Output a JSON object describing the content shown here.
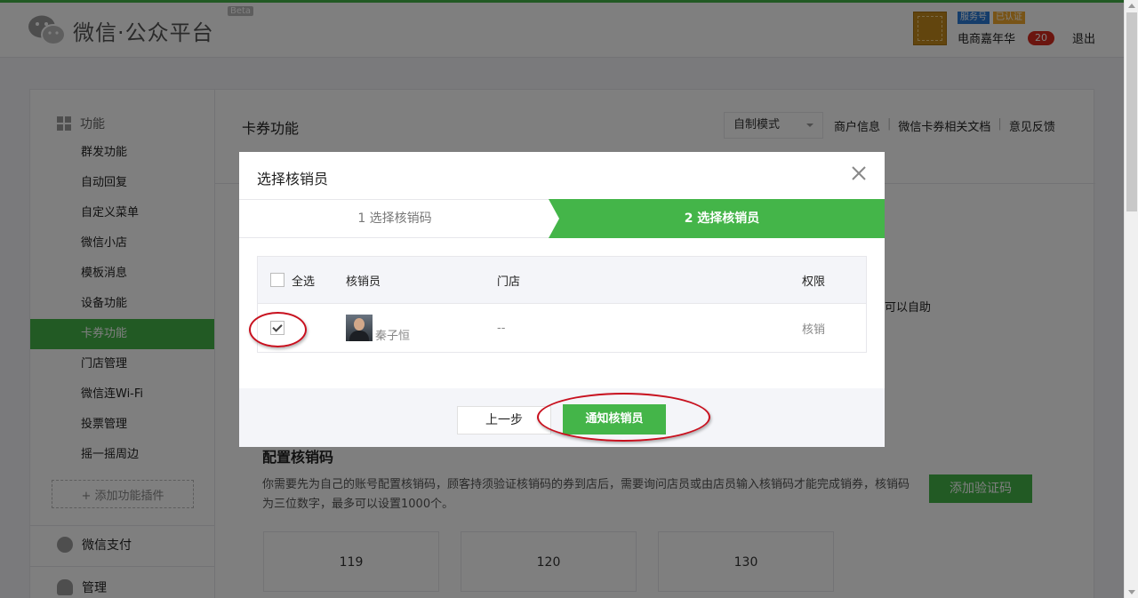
{
  "header": {
    "logo_text": "微信·公众平台",
    "beta": "Beta",
    "badge_service": "服务号",
    "badge_verified": "已认证",
    "account_name": "电商嘉年华",
    "message_count": "20",
    "logout": "退出"
  },
  "sidebar": {
    "group_function": "功能",
    "items": [
      "群发功能",
      "自动回复",
      "自定义菜单",
      "微信小店",
      "模板消息",
      "设备功能",
      "卡券功能",
      "门店管理",
      "微信连Wi-Fi",
      "投票管理",
      "摇一摇周边"
    ],
    "active_item": "卡券功能",
    "add_plugin": "+ 添加功能插件",
    "group_pay": "微信支付",
    "group_manage": "管理"
  },
  "content": {
    "title": "卡券功能",
    "mode_select": "自制模式",
    "links": [
      "商户信息",
      "微信卡券相关文档",
      "意见反馈"
    ],
    "tail_text": "可以自助",
    "section_title": "配置核销码",
    "section_desc": "你需要先为自己的账号配置核销码，顾客持须验证核销码的券到店后，需要询问店员或由店员输入核销码才能完成销券，核销码为三位数字，最多可以设置1000个。",
    "add_code_button": "添加验证码",
    "codes": [
      "119",
      "120",
      "130"
    ]
  },
  "dialog": {
    "title": "选择核销员",
    "step1": "1 选择核销码",
    "step2": "2 选择核销员",
    "table": {
      "headers": {
        "select_all": "全选",
        "staff": "核销员",
        "store": "门店",
        "permission": "权限"
      },
      "rows": [
        {
          "checked": true,
          "name": "秦子恒",
          "store": "--",
          "permission": "核销"
        }
      ]
    },
    "prev_button": "上一步",
    "notify_button": "通知核销员"
  },
  "colors": {
    "brand_green": "#44b549",
    "annotation_red": "#c8101e",
    "badge_blue": "#2b7bd6",
    "badge_orange": "#f0a92e"
  }
}
